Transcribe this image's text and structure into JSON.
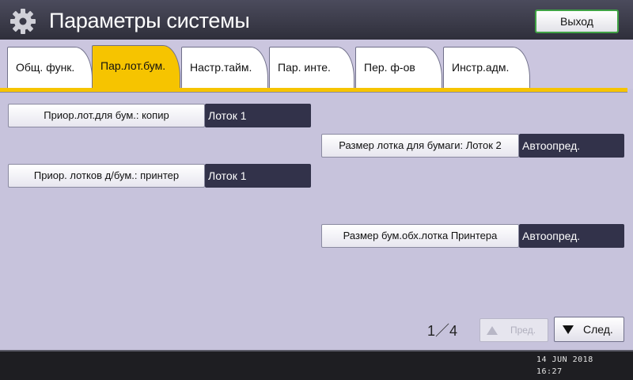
{
  "header": {
    "title": "Параметры системы",
    "exit_label": "Выход",
    "icon": "gear-icon"
  },
  "tabs": [
    {
      "label": "Общ. функ.",
      "active": false
    },
    {
      "label": "Пар.лот.бум.",
      "active": true
    },
    {
      "label": "Настр.тайм.",
      "active": false
    },
    {
      "label": "Пар. инте.",
      "active": false
    },
    {
      "label": "Пер. ф-ов",
      "active": false
    },
    {
      "label": "Инстр.адм.",
      "active": false
    }
  ],
  "settings": {
    "copier_priority": {
      "label": "Приор.лот.для бум.: копир",
      "value": "Лоток 1"
    },
    "printer_priority": {
      "label": "Приор. лотков д/бум.: принтер",
      "value": "Лоток 1"
    },
    "tray1_size": {
      "label": "Размер лотка для бумаги: Лоток 2",
      "value": "Автоопред."
    },
    "bypass_size": {
      "label": "Размер бум.обх.лотка Принтера",
      "value": "Автоопред."
    }
  },
  "pagination": {
    "current": "1",
    "separator": "／",
    "total": "4",
    "prev_label": "Пред.",
    "next_label": "След."
  },
  "status": {
    "date": "14 JUN  2018",
    "time": "16:27"
  },
  "colors": {
    "accent_tab": "#f6c400",
    "exit_border": "#3fa244",
    "value_box": "#32324a",
    "background": "#c7c3dc"
  }
}
